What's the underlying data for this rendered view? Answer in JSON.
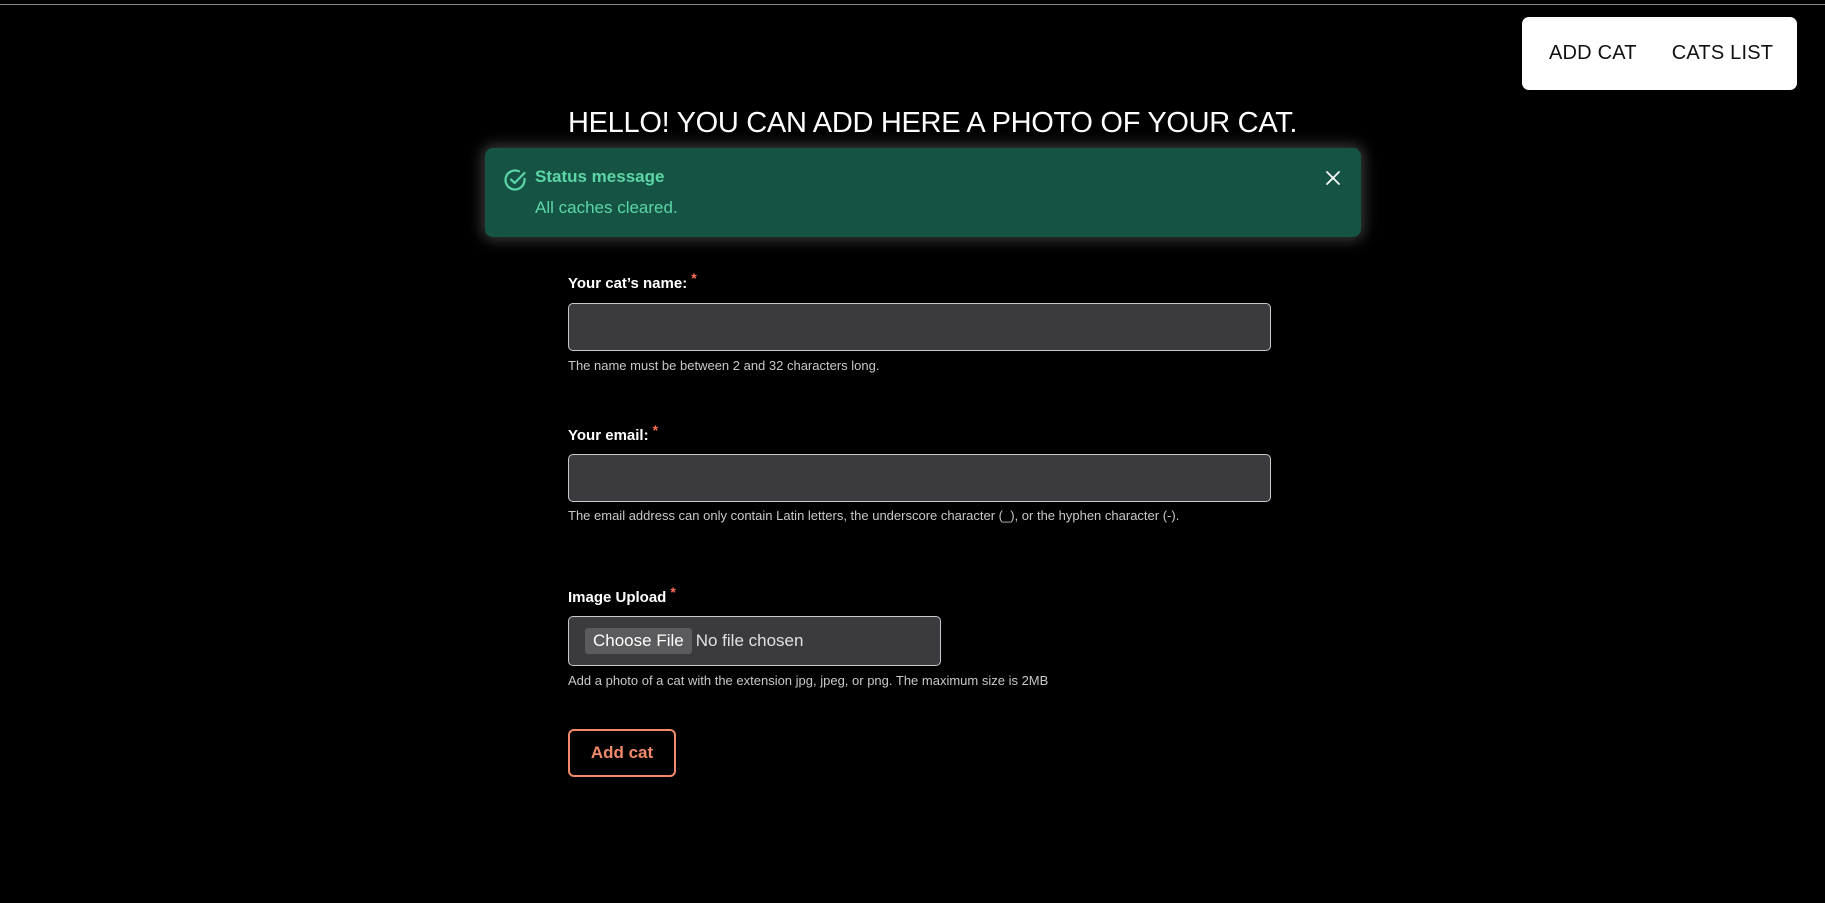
{
  "nav": {
    "add_cat": "ADD CAT",
    "cats_list": "CATS LIST"
  },
  "page": {
    "title": "HELLO! YOU CAN ADD HERE A PHOTO OF YOUR CAT."
  },
  "status": {
    "heading": "Status message",
    "text": "All caches cleared.",
    "icon": "check-circle-icon",
    "close_icon": "close-icon",
    "color_bg": "#155445",
    "color_text": "#5cd6a6"
  },
  "form": {
    "name": {
      "label": "Your cat’s name:",
      "required_mark": "*",
      "value": "",
      "hint": "The name must be between 2 and 32 characters long."
    },
    "email": {
      "label": "Your email:",
      "required_mark": "*",
      "value": "",
      "hint": "The email address can only contain Latin letters, the underscore character (_), or the hyphen character (-)."
    },
    "image": {
      "label": "Image Upload",
      "required_mark": "*",
      "button": "Choose File",
      "status": "No file chosen",
      "hint": "Add a photo of a cat with the extension jpg, jpeg, or png. The maximum size is 2MB"
    },
    "submit": "Add cat"
  },
  "colors": {
    "accent": "#f08a6b",
    "required": "#ff6e57"
  }
}
